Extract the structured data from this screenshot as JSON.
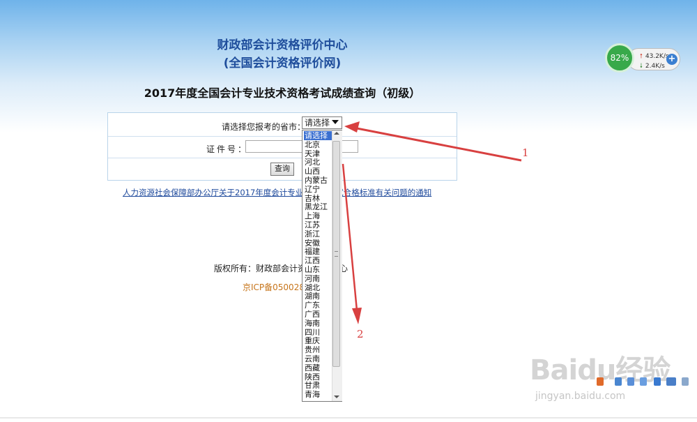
{
  "header": {
    "org_name": "财政部会计资格评价中心",
    "org_site": "(全国会计资格评价网)",
    "page_title": "2017年度全国会计专业技术资格考试成绩查询（初级）"
  },
  "form": {
    "province_label": "请选择您报考的省市：",
    "province_selected": "请选择",
    "cert_label": "证件号：",
    "cert_value": "",
    "query_button": "查询"
  },
  "dropdown": {
    "options": [
      "请选择",
      "北京",
      "天津",
      "河北",
      "山西",
      "内蒙古",
      "辽宁",
      "吉林",
      "黑龙江",
      "上海",
      "江苏",
      "浙江",
      "安徽",
      "福建",
      "江西",
      "山东",
      "河南",
      "湖北",
      "湖南",
      "广东",
      "广西",
      "海南",
      "四川",
      "重庆",
      "贵州",
      "云南",
      "西藏",
      "陕西",
      "甘肃",
      "青海"
    ],
    "selected_index": 0
  },
  "notice_link": "人力资源社会保障部办公厅关于2017年度会计专业技…格考试合格标准有关问题的通知",
  "footer": {
    "copyright": "版权所有：财政部会计资格评价中心",
    "icp": "京ICP备050028"
  },
  "annotations": {
    "label1": "1",
    "label2": "2",
    "arrow_color": "#d84040"
  },
  "speed_widget": {
    "percent": "82%",
    "upload": "43.2K/s",
    "download": "2.4K/s",
    "plus": "+"
  },
  "watermark": {
    "logo_text": "Baidu经验",
    "url": "jingyan.baidu.com"
  },
  "colors": {
    "title_blue": "#1f4e9c",
    "link_blue": "#1f4a9c",
    "icp_orange": "#c6741a",
    "widget_green": "#38a94a",
    "dropdown_selected": "#3a6fd0"
  }
}
